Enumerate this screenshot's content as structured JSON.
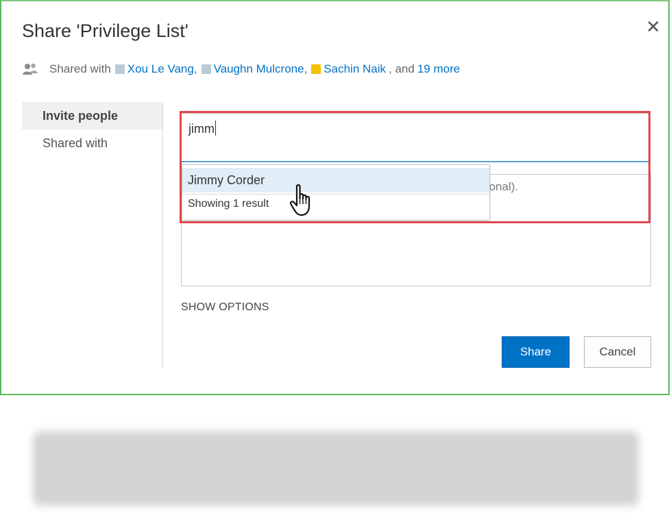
{
  "dialog": {
    "title": "Share 'Privilege List'",
    "close_icon": "close-icon"
  },
  "shared_with": {
    "label": "Shared with",
    "people": [
      {
        "name": "Xou Le Vang",
        "color": "#b7cbd6"
      },
      {
        "name": "Vaughn Mulcrone",
        "color": "#b7cbd6"
      },
      {
        "name": "Sachin Naik",
        "color": "#f2c200"
      }
    ],
    "separator": ",",
    "and_text": ", and",
    "more_link": "19 more"
  },
  "nav": {
    "items": [
      {
        "label": "Invite people",
        "active": true
      },
      {
        "label": "Shared with",
        "active": false
      }
    ]
  },
  "invite": {
    "value": "jimm"
  },
  "suggestions": {
    "items": [
      "Jimmy Corder"
    ],
    "count_text": "Showing 1 result"
  },
  "message": {
    "visible_placeholder_fragment": "tional)."
  },
  "options": {
    "show_options": "SHOW OPTIONS"
  },
  "buttons": {
    "share": "Share",
    "cancel": "Cancel"
  },
  "colors": {
    "accent": "#0072c6",
    "highlight": "#e0454a",
    "dialog_border": "#5cb85c",
    "suggestion_hover": "#e1edf7"
  }
}
